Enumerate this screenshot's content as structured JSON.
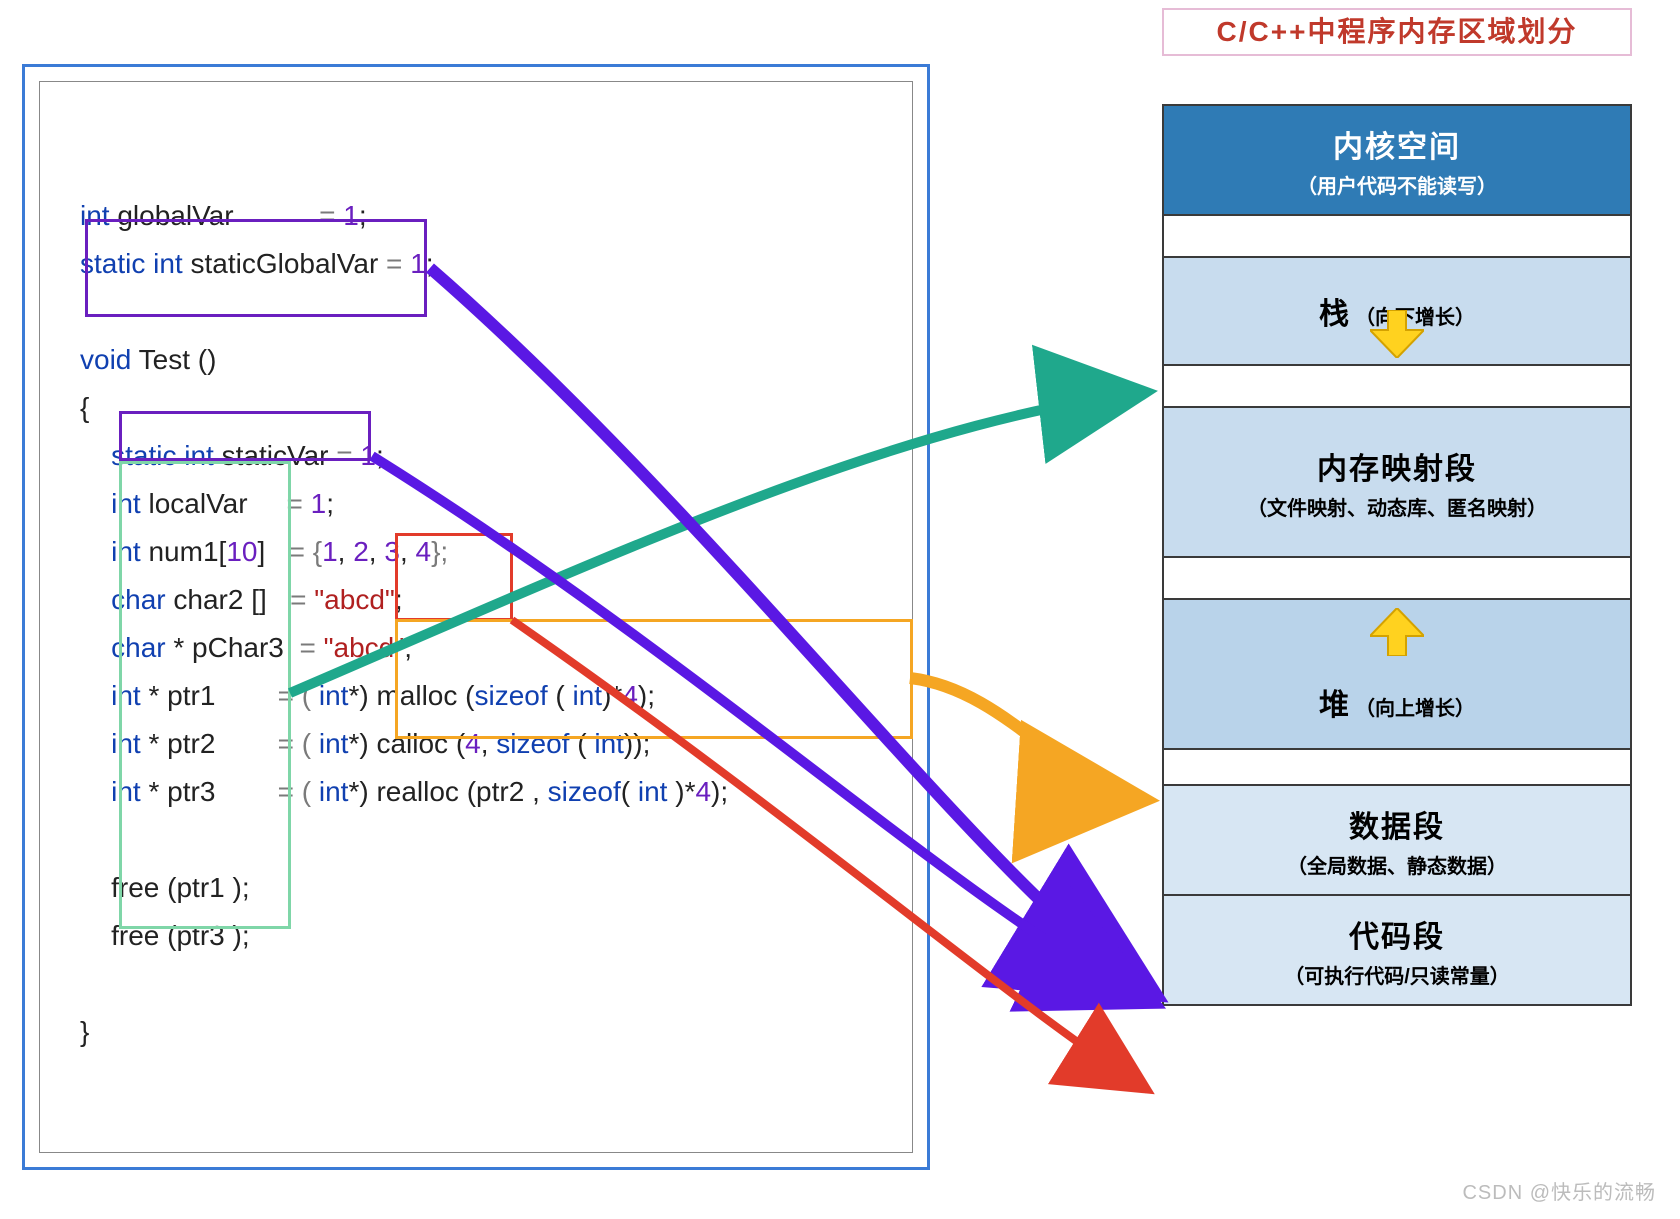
{
  "title": "C/C++中程序内存区域划分",
  "code": {
    "l01a": "int",
    "l01b": " globalVar           ",
    "l01c": "= ",
    "l01d": "1",
    "l01e": ";",
    "l02a": "static int",
    "l02b": " staticGlobalVar ",
    "l02c": "= ",
    "l02d": "1",
    "l02e": ";",
    "l04a": "void",
    "l04b": " Test ()",
    "l05": "{",
    "l06a": "    static int",
    "l06b": " staticVar ",
    "l06c": "= ",
    "l06d": "1",
    "l06e": ";",
    "l07a": "    int",
    "l07b": " localVar     ",
    "l07c": "= ",
    "l07d": "1",
    "l07e": ";",
    "l08a": "    int",
    "l08b": " num1[",
    "l08c": "10",
    "l08d": "]   ",
    "l08e": "= {",
    "l08f": "1",
    "l08g": ", ",
    "l08h": "2",
    "l08i": ", ",
    "l08j": "3",
    "l08k": ", ",
    "l08l": "4",
    "l08m": "};",
    "l09a": "    char",
    "l09b": " char2 []   ",
    "l09c": "= ",
    "l09d": "\"abcd\"",
    "l09e": ";",
    "l10a": "    char",
    "l10b": " * pChar3  ",
    "l10c": "= ",
    "l10d": "\"abcd\"",
    "l10e": ";",
    "l11a": "    int",
    "l11b": " * ptr1        ",
    "l11c": "= ( ",
    "l11d": "int",
    "l11e": "*) malloc (",
    "l11f": "sizeof",
    "l11g": " ( ",
    "l11h": "int",
    "l11i": ")*",
    "l11j": "4",
    "l11k": ");",
    "l12a": "    int",
    "l12b": " * ptr2        ",
    "l12c": "= ( ",
    "l12d": "int",
    "l12e": "*) calloc (",
    "l12f": "4",
    "l12g": ", ",
    "l12h": "sizeof",
    "l12i": " ( ",
    "l12j": "int",
    "l12k": "));",
    "l13a": "    int",
    "l13b": " * ptr3        ",
    "l13c": "= ( ",
    "l13d": "int",
    "l13e": "*) realloc (ptr2 , ",
    "l13f": "sizeof",
    "l13g": "( ",
    "l13h": "int",
    "l13i": " )*",
    "l13j": "4",
    "l13k": ");",
    "l15a": "    free (ptr1 );",
    "l16a": "    free (ptr3 );",
    "l18": "}"
  },
  "memory": {
    "kernel_title": "内核空间",
    "kernel_sub": "（用户代码不能读写）",
    "stack_title": "栈",
    "stack_sub": "（向下增长）",
    "mmap_title": "内存映射段",
    "mmap_sub": "（文件映射、动态库、匿名映射）",
    "heap_title": "堆",
    "heap_sub": "（向上增长）",
    "data_title": "数据段",
    "data_sub": "（全局数据、静态数据）",
    "code_title": "代码段",
    "code_sub": "（可执行代码/只读常量）"
  },
  "colors": {
    "kernel_bg": "#2f7bb5",
    "light1": "#c8dcee",
    "light2": "#b9d3ea",
    "light3": "#d7e6f3",
    "blank": "#ffffff",
    "arrow_yellow": "#ffd21f",
    "arrow_outline": "#d4a200"
  },
  "watermark": "CSDN @快乐的流畅"
}
